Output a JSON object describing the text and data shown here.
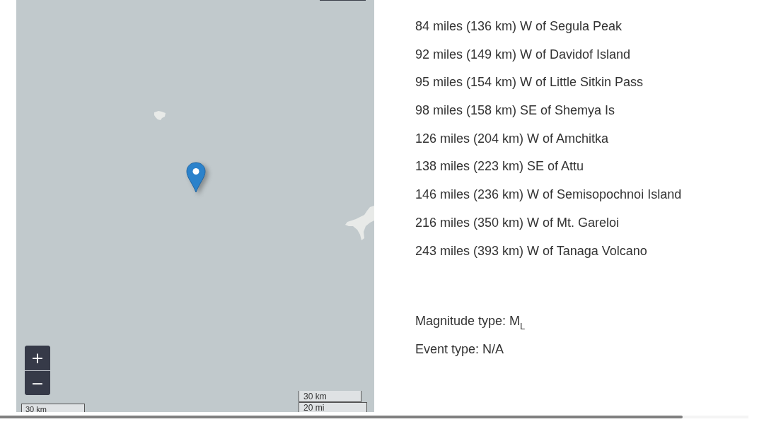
{
  "map": {
    "zoom_buttons": [
      {
        "label": "+"
      },
      {
        "label": "−"
      }
    ],
    "scale_left": {
      "label": "30 km"
    },
    "scale_right": [
      {
        "label": "30 km"
      },
      {
        "label": "20 mi"
      }
    ]
  },
  "nearby_places": [
    "84 miles (136 km) W of Segula Peak",
    "92 miles (149 km) W of Davidof Island",
    "95 miles (154 km) W of Little Sitkin Pass",
    "98 miles (158 km) SE of Shemya Is",
    "126 miles (204 km) W of Amchitka",
    "138 miles (223 km) SE of Attu",
    "146 miles (236 km) W of Semisopochnoi Island",
    "216 miles (350 km) W of Mt. Gareloi",
    "243 miles (393 km) W of Tanaga Volcano"
  ],
  "magnitude_type": "Magnitude type: M$_{L}$",
  "event_type": "Event type: N/A"
}
